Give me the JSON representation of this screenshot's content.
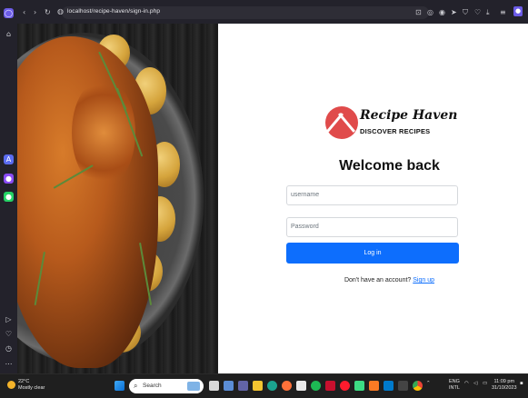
{
  "browser": {
    "url": "localhost/recipe-haven/sign-in.php",
    "nav": {
      "back": "‹",
      "forward": "›",
      "reload": "↻"
    }
  },
  "brand": {
    "name": "Recipe Haven",
    "tagline": "DISCOVER RECIPES",
    "logo_color": "#e04b4b"
  },
  "login": {
    "heading": "Welcome back",
    "username_placeholder": "username",
    "password_placeholder": "Password",
    "submit_label": "Log in",
    "signup_prompt": "Don't have an account?",
    "signup_link": "Sign up",
    "accent": "#0d6efd"
  },
  "taskbar": {
    "weather_temp": "22°C",
    "weather_desc": "Mostly clear",
    "search_placeholder": "Search",
    "lang_top": "ENG",
    "lang_bottom": "INTL",
    "time": "11:09 pm",
    "date": "31/10/2023"
  },
  "icons": {
    "sidebar": [
      "opera-logo-icon",
      "home-icon",
      "aria-icon",
      "messenger-icon",
      "whatsapp-icon",
      "player-icon",
      "heart-icon",
      "history-icon",
      "more-icon"
    ],
    "taskbar": [
      "windows-start-icon",
      "search-icon",
      "file-explorer-icon",
      "app-icon"
    ]
  }
}
